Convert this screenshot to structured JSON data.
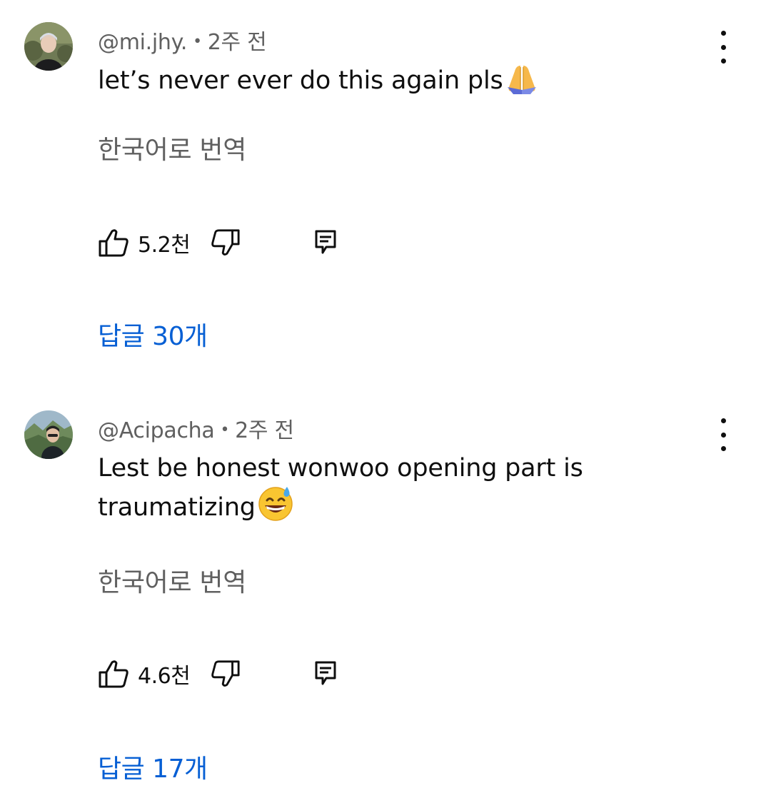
{
  "comments": [
    {
      "author": "@mi.jhy.",
      "time": "2주 전",
      "text": "let’s never ever do this again pls",
      "emoji_icon": "folded-hands-emoji",
      "translate_label": "한국어로 번역",
      "likes": "5.2천",
      "replies_label": "답글 30개"
    },
    {
      "author": "@Acipacha",
      "time": "2주 전",
      "text": "Lest be honest wonwoo opening part is traumatizing",
      "emoji_icon": "grinning-sweat-emoji",
      "translate_label": "한국어로 번역",
      "likes": "4.6천",
      "replies_label": "답글 17개"
    }
  ],
  "colors": {
    "meta_text": "#606060",
    "primary_text": "#0f0f0f",
    "link_blue": "#065fd4"
  },
  "icons": [
    "more-vert-icon",
    "thumb-up-icon",
    "thumb-down-icon",
    "comment-reply-icon"
  ]
}
